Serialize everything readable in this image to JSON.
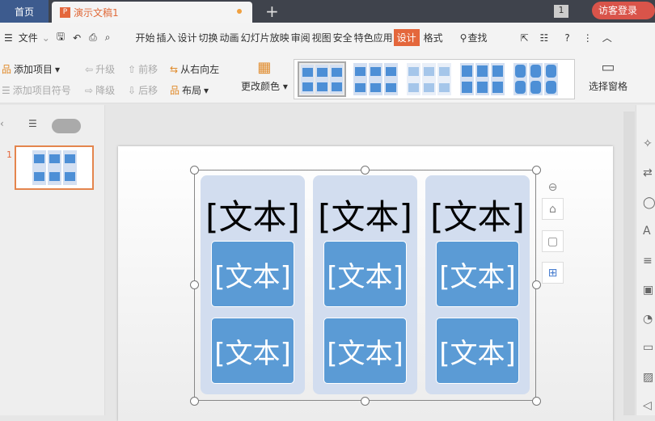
{
  "tabs": {
    "home": "首页",
    "doc": "演示文稿1",
    "doc_icon": "P",
    "page_count": "1",
    "login": "访客登录"
  },
  "menu": {
    "file": "文件",
    "items": [
      "开始",
      "插入",
      "设计",
      "切换",
      "动画",
      "幻灯片放映",
      "审阅",
      "视图",
      "安全",
      "特色应用"
    ],
    "active": "设计",
    "format": "格式",
    "find": "查找"
  },
  "ribbon": {
    "add_item": "添加项目",
    "add_bullet": "添加项目符号",
    "promote": "升级",
    "demote": "降级",
    "move_up": "前移",
    "move_down": "后移",
    "rtl": "从右向左",
    "layout": "布局",
    "change_color": "更改颜色",
    "select_pane": "选择窗格"
  },
  "left": {
    "slide_number": "1"
  },
  "smartart": {
    "columns": [
      {
        "header": "[文本]",
        "items": [
          "[文本]",
          "[文本]"
        ]
      },
      {
        "header": "[文本]",
        "items": [
          "[文本]",
          "[文本]"
        ]
      },
      {
        "header": "[文本]",
        "items": [
          "[文本]",
          "[文本]"
        ]
      }
    ]
  },
  "colors": {
    "accent": "#e4673c",
    "box": "#5b9bd5",
    "column": "#d2ddef"
  }
}
